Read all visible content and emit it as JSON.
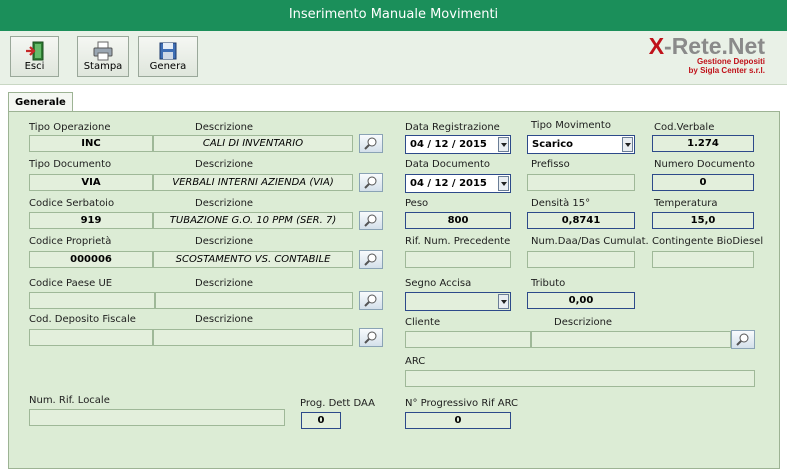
{
  "window": {
    "title": "Inserimento Manuale Movimenti"
  },
  "toolbar": {
    "esci": "Esci",
    "stampa": "Stampa",
    "genera": "Genera"
  },
  "logo": {
    "brand_x": "X",
    "brand_rest": "-Rete.Net",
    "line1": "Gestione Depositi",
    "line2": "by Sigla Center s.r.l."
  },
  "tabs": {
    "generale": "Generale"
  },
  "form": {
    "tipo_operazione": {
      "label": "Tipo Operazione",
      "desc_label": "Descrizione",
      "code": "INC",
      "desc": "CALI DI INVENTARIO"
    },
    "tipo_documento": {
      "label": "Tipo Documento",
      "desc_label": "Descrizione",
      "code": "VIA",
      "desc": "VERBALI INTERNI AZIENDA (VIA)"
    },
    "codice_serbatoio": {
      "label": "Codice Serbatoio",
      "desc_label": "Descrizione",
      "code": "919",
      "desc": "TUBAZIONE G.O. 10 PPM (SER. 7)"
    },
    "codice_proprieta": {
      "label": "Codice Proprietà",
      "desc_label": "Descrizione",
      "code": "000006",
      "desc": "SCOSTAMENTO VS. CONTABILE"
    },
    "codice_paese_ue": {
      "label": "Codice Paese UE",
      "desc_label": "Descrizione",
      "code": "",
      "desc": ""
    },
    "cod_deposito_fiscale": {
      "label": "Cod. Deposito Fiscale",
      "desc_label": "Descrizione",
      "code": "",
      "desc": ""
    },
    "num_rif_locale": {
      "label": "Num. Rif. Locale",
      "value": ""
    },
    "prog_dett_daa": {
      "label": "Prog. Dett DAA",
      "value": "0"
    },
    "data_registrazione": {
      "label": "Data Registrazione",
      "value": "04 / 12 / 2015"
    },
    "tipo_movimento": {
      "label": "Tipo Movimento",
      "value": "Scarico"
    },
    "cod_verbale": {
      "label": "Cod.Verbale",
      "value": "1.274"
    },
    "data_documento": {
      "label": "Data Documento",
      "value": "04 / 12 / 2015"
    },
    "prefisso": {
      "label": "Prefisso",
      "value": ""
    },
    "numero_documento": {
      "label": "Numero Documento",
      "value": "0"
    },
    "peso": {
      "label": "Peso",
      "value": "800"
    },
    "densita": {
      "label": "Densità 15°",
      "value": "0,8741"
    },
    "temperatura": {
      "label": "Temperatura",
      "value": "15,0"
    },
    "rif_num_precedente": {
      "label": "Rif. Num. Precedente",
      "value": ""
    },
    "num_daa_das": {
      "label": "Num.Daa/Das Cumulat.",
      "value": ""
    },
    "contingente": {
      "label": "Contingente BioDiesel",
      "value": ""
    },
    "segno_accisa": {
      "label": "Segno Accisa",
      "value": ""
    },
    "tributo": {
      "label": "Tributo",
      "value": "0,00"
    },
    "cliente": {
      "label": "Cliente",
      "desc_label": "Descrizione",
      "code": "",
      "desc": ""
    },
    "arc": {
      "label": "ARC",
      "value": ""
    },
    "progressivo_arc": {
      "label": "N° Progressivo Rif ARC",
      "value": "0"
    }
  }
}
